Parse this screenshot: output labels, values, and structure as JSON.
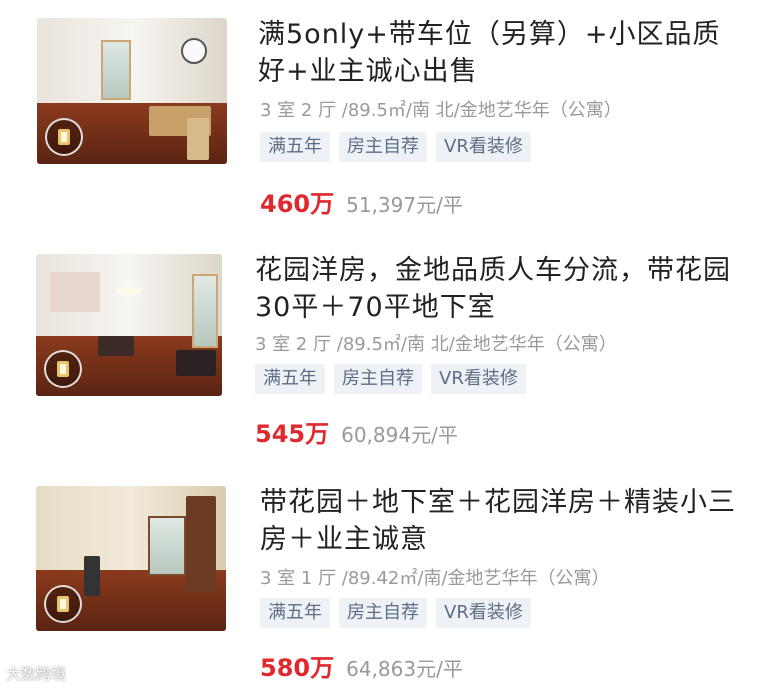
{
  "listings": [
    {
      "title": "满5only+带车位（另算）+小区品质好+业主诚心出售",
      "meta": "3 室 2 厅 /89.5㎡/南 北/金地艺华年（公寓）",
      "tags": [
        "满五年",
        "房主自荐",
        "VR看装修"
      ],
      "price": "460万",
      "unit_price": "51,397元/平"
    },
    {
      "title": "花园洋房，金地品质人车分流，带花园30平＋70平地下室",
      "meta": "3 室 2 厅 /89.5㎡/南 北/金地艺华年（公寓）",
      "tags": [
        "满五年",
        "房主自荐",
        "VR看装修"
      ],
      "price": "545万",
      "unit_price": "60,894元/平"
    },
    {
      "title": "带花园＋地下室＋花园洋房＋精装小三房＋业主诚意",
      "meta": "3 室 1 厅 /89.42㎡/南/金地艺华年（公寓）",
      "tags": [
        "满五年",
        "房主自荐",
        "VR看装修"
      ],
      "price": "580万",
      "unit_price": "64,863元/平"
    }
  ],
  "watermark": "大数跨境",
  "colors": {
    "price": "#e0292e",
    "tag_bg": "#eef2f7",
    "tag_text": "#5b6e86",
    "meta": "#9a9a9a"
  },
  "icons": {
    "vr_badge": "vr-360-icon"
  }
}
